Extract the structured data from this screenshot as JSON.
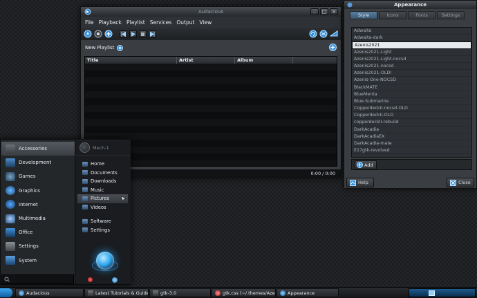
{
  "audacious": {
    "title": "Audacious",
    "menu": [
      "File",
      "Playback",
      "Playlist",
      "Services",
      "Output",
      "View"
    ],
    "playlist_name": "New Playlist",
    "columns": [
      "Title",
      "Artist",
      "Album"
    ],
    "time": "0:00 / 0:00"
  },
  "appearance": {
    "title": "Appearance",
    "tabs": [
      "Style",
      "Icons",
      "Fonts",
      "Settings"
    ],
    "active_tab": "Style",
    "themes": [
      "Adwaita",
      "Adwaita-dark",
      "Azenis2021",
      "Azenis2021-Light",
      "Azenis2021-Light-nocsd",
      "Azenis2021-nocsd",
      "Azenis2021-OLD!",
      "Azenis-One-NOCSD",
      "BlackMATE",
      "BlueMenta",
      "Blue-Submarine",
      "CopperdeckII-nocsd-OLD",
      "CopperdeckII-OLD",
      "copperdeckII-rebuild",
      "DarkAcadia",
      "DarkAcadiaEX",
      "DarkAcadia-mate",
      "E17gtk-revolved"
    ],
    "selected_theme": "Azenis2021",
    "add_label": "Add",
    "help_label": "Help",
    "close_label": "Close"
  },
  "start_menu": {
    "categories": [
      {
        "label": "Accessories",
        "icon": "accessories-icon"
      },
      {
        "label": "Development",
        "icon": "development-icon"
      },
      {
        "label": "Games",
        "icon": "games-icon"
      },
      {
        "label": "Graphics",
        "icon": "graphics-icon"
      },
      {
        "label": "Internet",
        "icon": "internet-icon"
      },
      {
        "label": "Multimedia",
        "icon": "multimedia-icon"
      },
      {
        "label": "Office",
        "icon": "office-icon"
      },
      {
        "label": "Settings",
        "icon": "settings-icon"
      },
      {
        "label": "System",
        "icon": "system-icon"
      }
    ],
    "active_category": "Accessories",
    "username": "Mech-1",
    "places": [
      "Home",
      "Documents",
      "Downloads",
      "Music",
      "Pictures",
      "Videos"
    ],
    "active_place": "Pictures",
    "system_items": [
      "Software",
      "Settings"
    ]
  },
  "taskbar": {
    "tasks": [
      {
        "label": "Audacious",
        "icon": "audacious-icon"
      },
      {
        "label": "Latest Tutorials & Guides",
        "icon": "browser-icon"
      },
      {
        "label": "gtk-3.0",
        "icon": "folder-icon"
      },
      {
        "label": "gtk.css (~/.themes/Azeni...",
        "icon": "editor-icon"
      },
      {
        "label": "Appearance",
        "icon": "appearance-icon"
      }
    ]
  },
  "colors": {
    "accent": "#2f8fe0",
    "window_bg": "#3a3d41",
    "desktop_bg": "#1b1d20"
  }
}
